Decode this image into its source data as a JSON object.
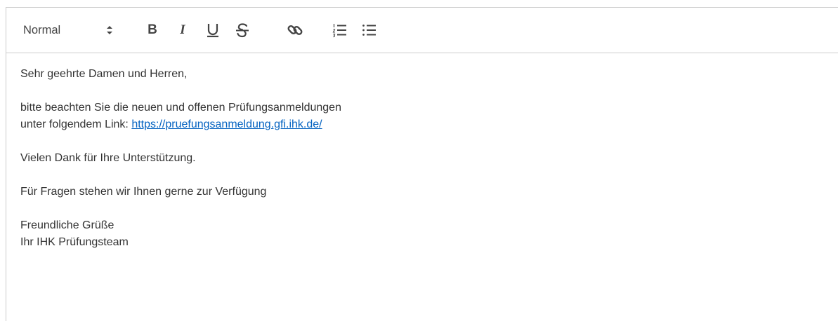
{
  "toolbar": {
    "format_select": "Normal",
    "icons": [
      "chevron-updown-icon",
      "bold-icon",
      "italic-icon",
      "underline-icon",
      "strikethrough-icon",
      "link-icon",
      "ordered-list-icon",
      "bullet-list-icon"
    ],
    "bold_glyph": "B",
    "italic_glyph": "I"
  },
  "content": {
    "greeting": "Sehr geehrte Damen und Herren,",
    "line1": "bitte beachten Sie die neuen und offenen Prüfungsanmeldungen",
    "line2_prefix": "unter folgendem Link: ",
    "link": "https://pruefungsanmeldung.gfi.ihk.de/",
    "thanks": "Vielen Dank für Ihre Unterstützung.",
    "questions": "Für Fragen stehen wir Ihnen gerne zur Verfügung",
    "closing": "Freundliche Grüße",
    "signature": "Ihr IHK Prüfungsteam"
  },
  "colors": {
    "border": "#cccccc",
    "link": "#0563c1",
    "text": "#333333",
    "icon": "#444444"
  }
}
